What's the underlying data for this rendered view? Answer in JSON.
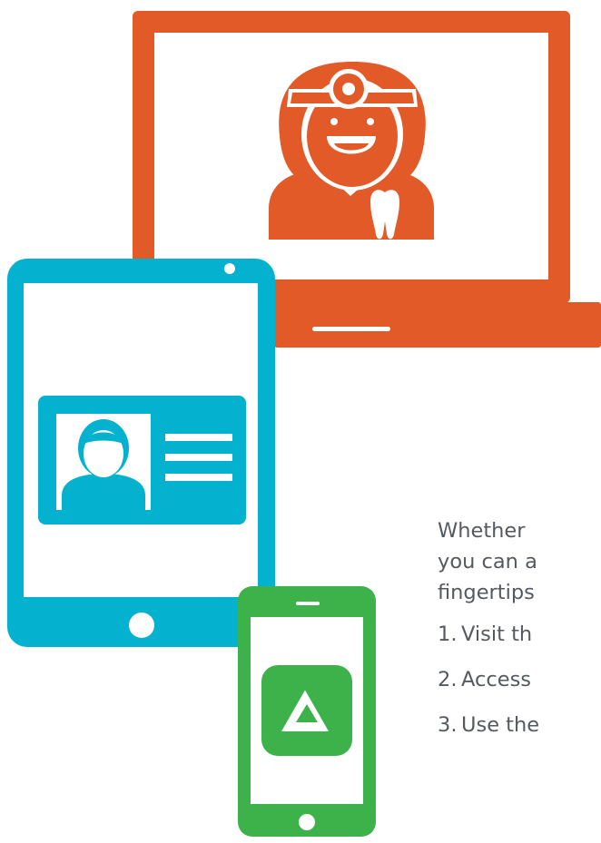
{
  "colors": {
    "laptop": "#e25a28",
    "tablet": "#04b1cf",
    "phone": "#3db24a",
    "white": "#ffffff",
    "text": "#555a60"
  },
  "icons": {
    "laptop": "laptop-icon",
    "dentist": "dentist-avatar-icon",
    "tooth": "tooth-icon",
    "tablet": "tablet-icon",
    "id_card": "id-card-icon",
    "phone": "phone-icon",
    "app": "app-logo-icon"
  },
  "copy": {
    "intro_line_1": "Whether",
    "intro_line_2": "you can a",
    "intro_line_3": "fingertips",
    "steps": [
      {
        "number": "1.",
        "text": "Visit th"
      },
      {
        "number": "2.",
        "text": "Access"
      },
      {
        "number": "3.",
        "text": "Use the"
      }
    ]
  }
}
